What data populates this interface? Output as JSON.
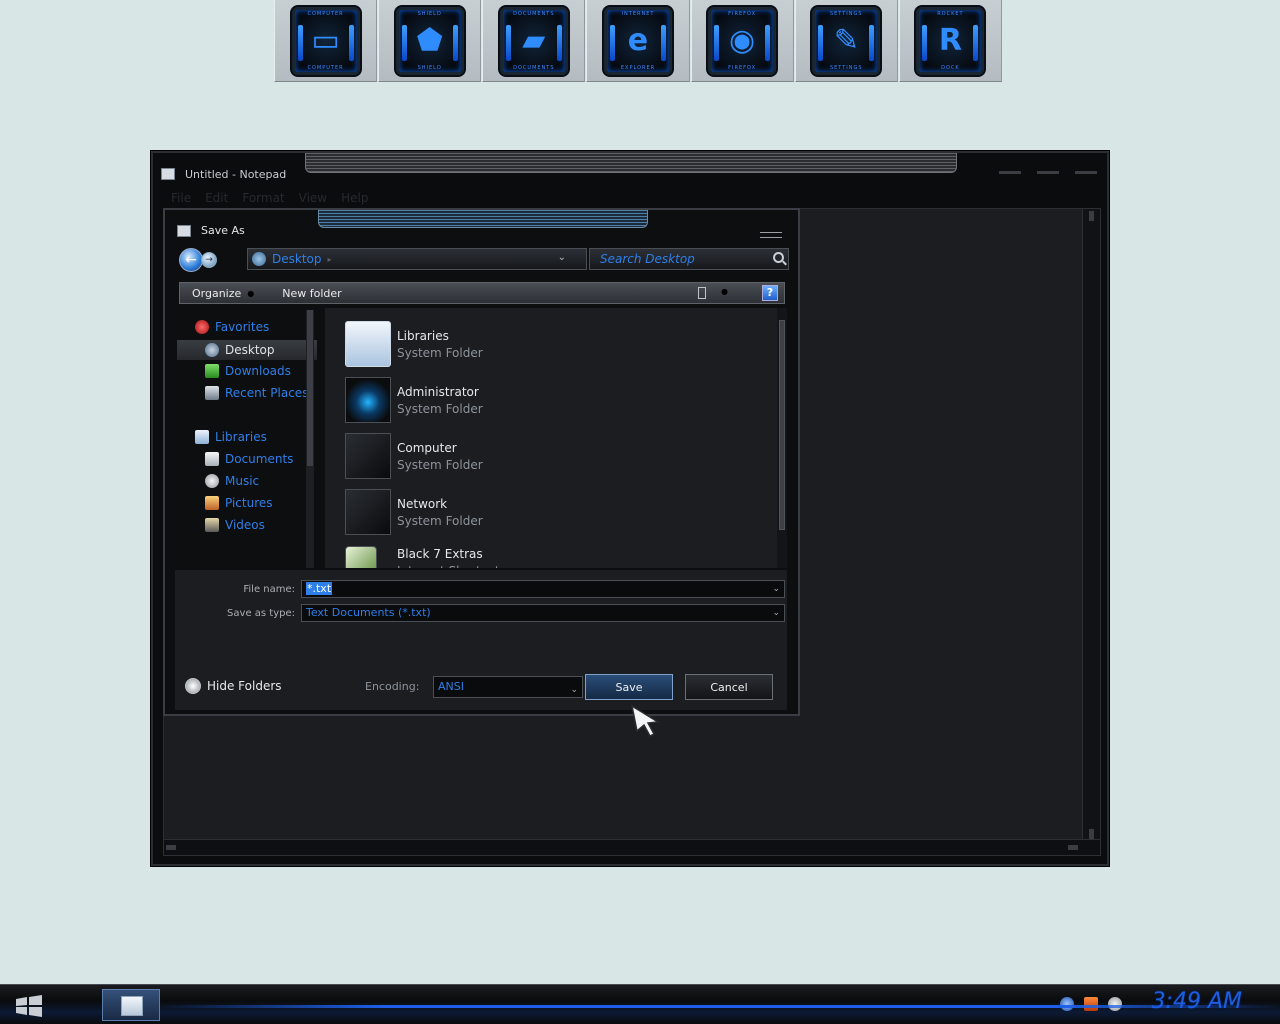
{
  "dock": {
    "items": [
      {
        "name": "computer",
        "top_caption": "COMPUTER",
        "bottom_caption": "COMPUTER",
        "glyph": "▭"
      },
      {
        "name": "shield",
        "top_caption": "SHIELD",
        "bottom_caption": "SHIELD",
        "glyph": "⬟"
      },
      {
        "name": "documents",
        "top_caption": "DOCUMENTS",
        "bottom_caption": "DOCUMENTS",
        "glyph": "▰"
      },
      {
        "name": "internet",
        "top_caption": "INTERNET",
        "bottom_caption": "EXPLORER",
        "glyph": "e"
      },
      {
        "name": "firefox",
        "top_caption": "FIREFOX",
        "bottom_caption": "FIREFOX",
        "glyph": "◉"
      },
      {
        "name": "settings",
        "top_caption": "SETTINGS",
        "bottom_caption": "SETTINGS",
        "glyph": "✎"
      },
      {
        "name": "rocket",
        "top_caption": "ROCKET",
        "bottom_caption": "DOCK",
        "glyph": "R"
      }
    ]
  },
  "notepad": {
    "title": "Untitled - Notepad",
    "menu": [
      "File",
      "Edit",
      "Format",
      "View",
      "Help"
    ]
  },
  "dialog": {
    "title": "Save As",
    "address": "Desktop",
    "search_placeholder": "Search Desktop",
    "toolbar": {
      "organize": "Organize",
      "new_folder": "New folder",
      "help": "?"
    },
    "nav": {
      "favorites": "Favorites",
      "desktop": "Desktop",
      "downloads": "Downloads",
      "recent_places": "Recent Places",
      "libraries": "Libraries",
      "documents": "Documents",
      "music": "Music",
      "pictures": "Pictures",
      "videos": "Videos"
    },
    "files": [
      {
        "name": "Libraries",
        "type": "System Folder",
        "icon": "folder-icon"
      },
      {
        "name": "Administrator",
        "type": "System Folder",
        "icon": "user-icon"
      },
      {
        "name": "Computer",
        "type": "System Folder",
        "icon": "computer-icon"
      },
      {
        "name": "Network",
        "type": "System Folder",
        "icon": "network-icon"
      },
      {
        "name": "Black 7 Extras",
        "type": "Internet Shortcut",
        "icon": "shortcut-icon"
      }
    ],
    "file_name_label": "File name:",
    "file_name_value": "*.txt",
    "save_as_type_label": "Save as type:",
    "save_as_type_value": "Text Documents (*.txt)",
    "hide_folders": "Hide Folders",
    "encoding_label": "Encoding:",
    "encoding_value": "ANSI",
    "save": "Save",
    "cancel": "Cancel"
  },
  "taskbar": {
    "clock": "3:49 AM"
  },
  "colors": {
    "accent": "#2f7fe8",
    "desktop_bg": "#d9e6e6",
    "window_bg": "#0d0e10"
  }
}
